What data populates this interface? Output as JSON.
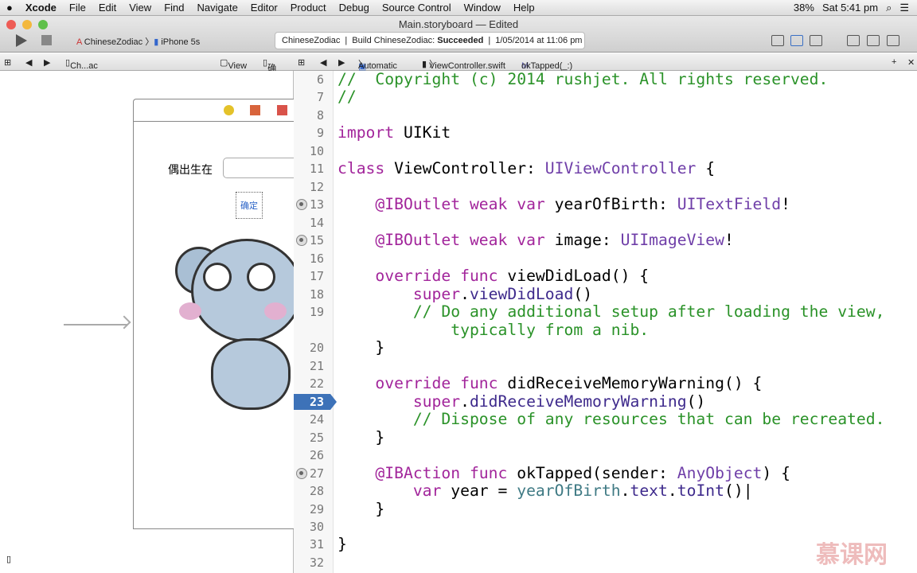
{
  "menubar": {
    "apple": "",
    "app": "Xcode",
    "items": [
      "File",
      "Edit",
      "View",
      "Find",
      "Navigate",
      "Editor",
      "Product",
      "Debug",
      "Source Control",
      "Window",
      "Help"
    ],
    "battery": "38%",
    "clock": "Sat 5:41 pm"
  },
  "window": {
    "title": "Main.storyboard — Edited"
  },
  "toolbar": {
    "scheme": "ChineseZodiac",
    "device": "iPhone 5s",
    "activity": {
      "project": "ChineseZodiac",
      "status_prefix": "Build ChineseZodiac:",
      "status": "Succeeded",
      "timestamp": "1/05/2014 at 11:06 pm"
    }
  },
  "left_jumpbar": {
    "items": [
      "Ch...ac",
      "View",
      "确定"
    ]
  },
  "right_jumpbar": {
    "items": [
      "Automatic",
      "ViewController.swift",
      "okTapped(_:)"
    ]
  },
  "storyboard": {
    "label": "偶出生在",
    "button": "确定"
  },
  "editor": {
    "current_line": 23,
    "breakpoints": [
      13,
      15,
      27
    ],
    "lines": [
      {
        "n": "6",
        "t": [
          [
            "comment",
            "//  Copyright (c) 2014 rushjet. All rights reserved."
          ]
        ]
      },
      {
        "n": "7",
        "t": [
          [
            "comment",
            "//"
          ]
        ]
      },
      {
        "n": "8",
        "t": []
      },
      {
        "n": "9",
        "t": [
          [
            "kw",
            "import"
          ],
          [
            "p",
            " UIKit"
          ]
        ]
      },
      {
        "n": "10",
        "t": []
      },
      {
        "n": "11",
        "t": [
          [
            "kw",
            "class"
          ],
          [
            "p",
            " ViewController: "
          ],
          [
            "type",
            "UIViewController"
          ],
          [
            "p",
            " {"
          ]
        ]
      },
      {
        "n": "12",
        "t": []
      },
      {
        "n": "13",
        "t": [
          [
            "p",
            "    "
          ],
          [
            "kw",
            "@IBOutlet weak var"
          ],
          [
            "p",
            " yearOfBirth: "
          ],
          [
            "type",
            "UITextField"
          ],
          [
            "p",
            "!"
          ]
        ]
      },
      {
        "n": "14",
        "t": []
      },
      {
        "n": "15",
        "t": [
          [
            "p",
            "    "
          ],
          [
            "kw",
            "@IBOutlet weak var"
          ],
          [
            "p",
            " image: "
          ],
          [
            "type",
            "UIImageView"
          ],
          [
            "p",
            "!"
          ]
        ]
      },
      {
        "n": "16",
        "t": []
      },
      {
        "n": "17",
        "t": [
          [
            "p",
            "    "
          ],
          [
            "kw",
            "override func"
          ],
          [
            "p",
            " viewDidLoad() {"
          ]
        ]
      },
      {
        "n": "18",
        "t": [
          [
            "p",
            "        "
          ],
          [
            "kw",
            "super"
          ],
          [
            "p",
            "."
          ],
          [
            "call",
            "viewDidLoad"
          ],
          [
            "p",
            "()"
          ]
        ]
      },
      {
        "n": "19",
        "t": [
          [
            "p",
            "        "
          ],
          [
            "comment",
            "// Do any additional setup after loading the view,"
          ]
        ]
      },
      {
        "n": "",
        "t": [
          [
            "p",
            "            "
          ],
          [
            "comment",
            "typically from a nib."
          ]
        ]
      },
      {
        "n": "20",
        "t": [
          [
            "p",
            "    }"
          ]
        ]
      },
      {
        "n": "21",
        "t": []
      },
      {
        "n": "22",
        "t": [
          [
            "p",
            "    "
          ],
          [
            "kw",
            "override func"
          ],
          [
            "p",
            " didReceiveMemoryWarning() {"
          ]
        ]
      },
      {
        "n": "23",
        "t": [
          [
            "p",
            "        "
          ],
          [
            "kw",
            "super"
          ],
          [
            "p",
            "."
          ],
          [
            "call",
            "didReceiveMemoryWarning"
          ],
          [
            "p",
            "()"
          ]
        ]
      },
      {
        "n": "24",
        "t": [
          [
            "p",
            "        "
          ],
          [
            "comment",
            "// Dispose of any resources that can be recreated."
          ]
        ]
      },
      {
        "n": "25",
        "t": [
          [
            "p",
            "    }"
          ]
        ]
      },
      {
        "n": "26",
        "t": []
      },
      {
        "n": "27",
        "t": [
          [
            "p",
            "    "
          ],
          [
            "kw",
            "@IBAction func"
          ],
          [
            "p",
            " okTapped(sender: "
          ],
          [
            "type",
            "AnyObject"
          ],
          [
            "p",
            ") {"
          ]
        ]
      },
      {
        "n": "28",
        "t": [
          [
            "p",
            "        "
          ],
          [
            "kw",
            "var"
          ],
          [
            "p",
            " year = "
          ],
          [
            "var",
            "yearOfBirth"
          ],
          [
            "p",
            "."
          ],
          [
            "call",
            "text"
          ],
          [
            "p",
            "."
          ],
          [
            "call",
            "toInt"
          ],
          [
            "p",
            "()|"
          ]
        ]
      },
      {
        "n": "29",
        "t": [
          [
            "p",
            "    }"
          ]
        ]
      },
      {
        "n": "30",
        "t": []
      },
      {
        "n": "31",
        "t": [
          [
            "p",
            "}"
          ]
        ]
      },
      {
        "n": "32",
        "t": []
      }
    ]
  },
  "watermark": "慕课网",
  "colors": {
    "comment": "#2a9228",
    "keyword": "#a2259b",
    "type": "#6f3ea8",
    "current_line": "#3d72b8"
  }
}
